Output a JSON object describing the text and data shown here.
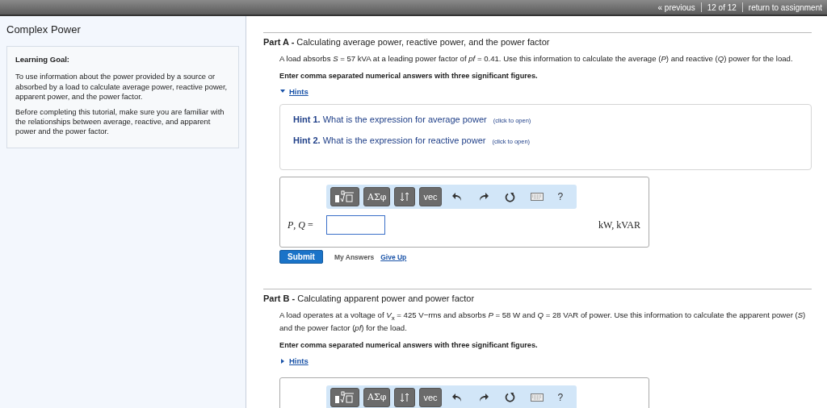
{
  "top_bar": {
    "previous": "« previous",
    "position": "12 of 12",
    "return": "return to assignment"
  },
  "sidebar": {
    "title": "Complex Power",
    "goal_heading": "Learning Goal:",
    "paragraphs": [
      "To use information about the power provided by a source or absorbed by a load to calculate average power, reactive power, apparent power, and the power factor.",
      "Before completing this tutorial, make sure you are familiar with the relationships between average, reactive, and apparent power and the power factor."
    ]
  },
  "parts": [
    {
      "label": "Part A -",
      "title": "Calculating average power, reactive power, and the power factor",
      "text": "A load absorbs *S* = 57 kVA at a leading power factor of *pf* = 0.41. Use this information to calculate the average (*P*) and reactive (*Q*) power for the load.",
      "instruction": "Enter comma separated numerical answers with three significant figures.",
      "hints_label": "Hints",
      "hints_expanded": true,
      "hints": [
        {
          "number": "Hint 1.",
          "text": "What is the expression for average power",
          "action": "(click to open)"
        },
        {
          "number": "Hint 2.",
          "text": "What is the expression for reactive power",
          "action": "(click to open)"
        }
      ],
      "answer": {
        "toolbar": {
          "symbols": "ΑΣφ",
          "vector": "vec",
          "help": "?"
        },
        "label": "*P*, *Q* =",
        "units": "kW, kVAR",
        "submit": "Submit",
        "my_answers": "My Answers",
        "give_up": "Give Up"
      }
    },
    {
      "label": "Part B -",
      "title": "Calculating apparent power and power factor",
      "text": "A load operates at a voltage of *V*$_{x}$ = 425 V−rms and absorbs *P* = 58 W and *Q* = 28 VAR of power. Use this information to calculate the apparent power (*S*) and the power factor (*pf*) for the load.",
      "instruction": "Enter comma separated numerical answers with three significant figures.",
      "hints_label": "Hints",
      "hints_expanded": false,
      "answer": {
        "toolbar": {
          "symbols": "ΑΣφ",
          "vector": "vec",
          "help": "?"
        }
      }
    }
  ]
}
